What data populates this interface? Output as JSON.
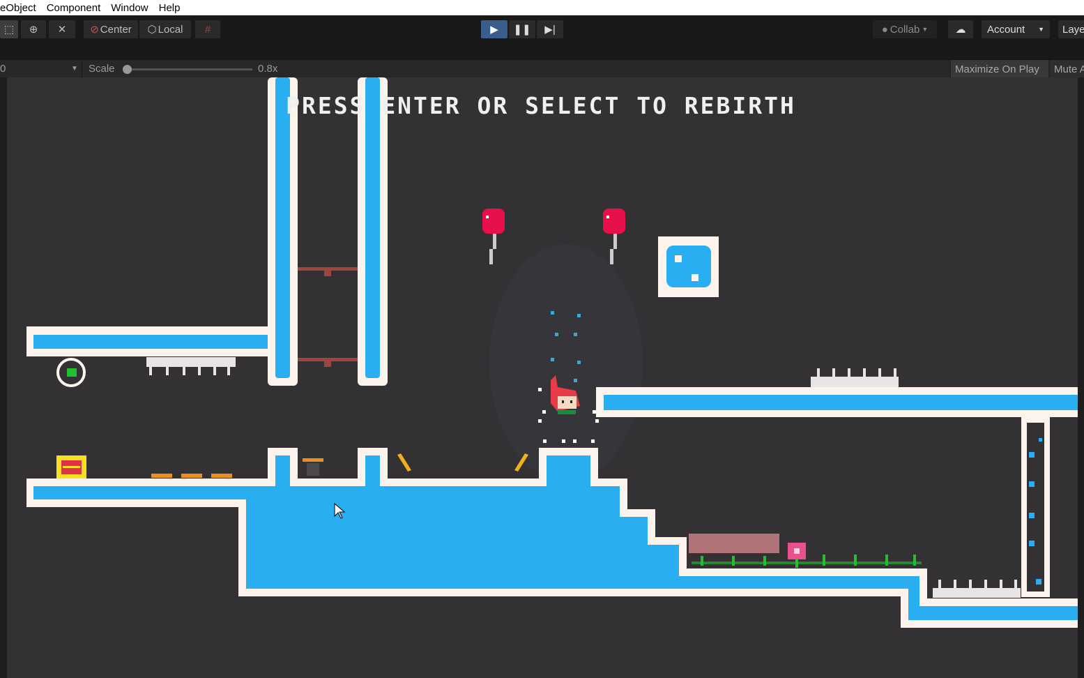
{
  "menu": [
    "eObject",
    "Component",
    "Window",
    "Help"
  ],
  "toolbar": {
    "center": "Center",
    "local": "Local",
    "collab": "Collab",
    "account": "Account",
    "layers": "Laye"
  },
  "gamebar": {
    "display": "0",
    "scale_label": "Scale",
    "scale_value": "0.8x",
    "scale_fraction": 0.05,
    "maximize": "Maximize On Play",
    "mute": "Mute A"
  },
  "game": {
    "banner": "PRESS ENTER OR SELECT TO REBIRTH"
  },
  "colors": {
    "bg": "#333134",
    "water": "#2aaef2",
    "edge": "#fbf3ec",
    "balloon": "#e8104a",
    "brick": "#a0453a"
  }
}
